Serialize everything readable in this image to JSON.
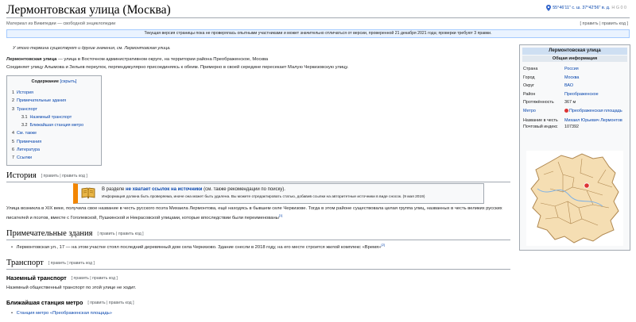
{
  "page": {
    "title": "Лермонтовская улица (Москва)",
    "subtitle": "Материал из Википедии — свободной энциклопедии",
    "coords": "55°46′11″ с. ш. 37°42′56″ в. д.",
    "coords_extra": "H G 0 0",
    "edit_top": "[ править | править код ]"
  },
  "flagged": {
    "text": "Текущая версия страницы пока не проверялась опытными участниками и может значительно отличаться от версии, проверенной 21 декабря 2021 года; проверки требуют 3 правки."
  },
  "hatnote": "У этого термина существуют и другие значения, см. Лермонтовская улица.",
  "lead": {
    "p1_bold": "Лермонтовская улица",
    "p1_rest": " — улица в Восточном административном округе, на территории района Преображенское, Москва",
    "p2": "Соединяет улицу Алымова и Зельев переулок, перпендикулярно присоединяясь к обеим. Примерно в своей середине пересекает Малую Черкизовскую улицу."
  },
  "toc": {
    "title": "Содержание",
    "toggle": "[скрыть]",
    "items": [
      {
        "num": "1",
        "label": "История"
      },
      {
        "num": "2",
        "label": "Примечательные здания"
      },
      {
        "num": "3",
        "label": "Транспорт"
      },
      {
        "num": "3.1",
        "label": "Наземный транспорт"
      },
      {
        "num": "3.2",
        "label": "Ближайшая станция метро"
      },
      {
        "num": "4",
        "label": "См. также"
      },
      {
        "num": "5",
        "label": "Примечания"
      },
      {
        "num": "6",
        "label": "Литература"
      },
      {
        "num": "7",
        "label": "Ссылки"
      }
    ]
  },
  "edit_section": "[ править | править код ]",
  "history": {
    "heading": "История",
    "ambox_l1_pre": "В разделе ",
    "ambox_l1_bold": "не хватает ссылок на источники",
    "ambox_l1_post": " (см. также рекомендации по поиску).",
    "ambox_l2": "Информация должна быть проверяема, иначе она может быть удалена. Вы можете отредактировать статью, добавив ссылки на авторитетные источники в виде сносок. (9 мая 2019)",
    "text": "Улица возникла в XIX веке, получила свое название в честь русского поэта Михаила Лермонтова, ещё находясь в бывшем селе Черкизове. Тогда в этом районе существовала целая группа улиц, названных в честь великих русских писателей и поэтов, вместе с Гоголевской, Пушкинской и Некрасовской улицами, которые впоследствии были переименованы",
    "ref": "[1]"
  },
  "buildings": {
    "heading": "Примечательные здания",
    "item": "Лермонтовская ул., 17 — на этом участке стоял последний деревянный дом села Черкизово. Здание снесли в 2018 году, на его месте строится жилой комплекс «Время»",
    "ref": "[2]"
  },
  "transport": {
    "heading": "Транспорт",
    "sub1": "Наземный транспорт",
    "sub1_text": "Наземный общественный транспорт по этой улице не ходит.",
    "sub2": "Ближайшая станция метро",
    "sub2_item": "Станция метро «Преображенская площадь»"
  },
  "infobox": {
    "title": "Лермонтовская улица",
    "subtitle": "Общая информация",
    "rows": [
      {
        "k": "Страна",
        "v": "Россия"
      },
      {
        "k": "Город",
        "v": "Москва"
      },
      {
        "k": "Округ",
        "v": "ВАО"
      },
      {
        "k": "Район",
        "v": "Преображенское"
      },
      {
        "k": "Протяжённость",
        "v": "367 м"
      },
      {
        "k": "Метро",
        "v": "Преображенская площадь"
      },
      {
        "k": "Название в честь",
        "v": "Михаил Юрьевич Лермонтов"
      },
      {
        "k": "Почтовый индекс",
        "v": "107392"
      }
    ]
  },
  "colors": {
    "link": "#0645ad",
    "ambox_accent": "#f28500",
    "flag_bg": "#eaf3ff",
    "map_fill": "#f5deb3",
    "map_marker": "#d33"
  }
}
